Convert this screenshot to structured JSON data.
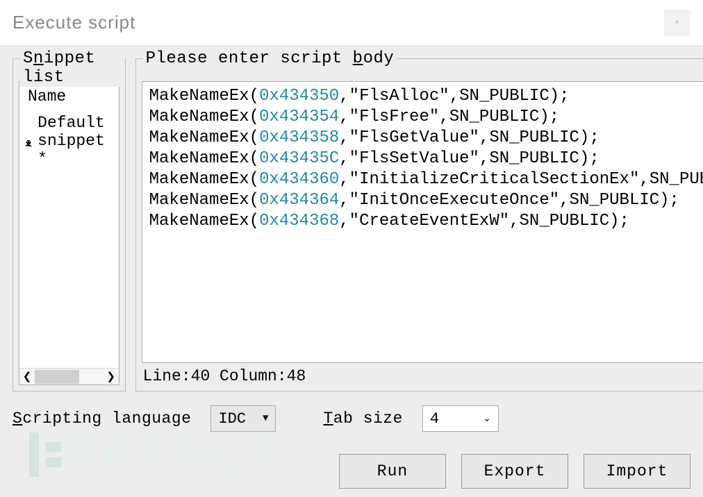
{
  "window": {
    "title": "Execute script"
  },
  "snippet_panel": {
    "legend_pre": "S",
    "legend_underlined": "n",
    "legend_post": "ippet list",
    "header": "Name",
    "items": [
      {
        "label": "Default snippet *"
      }
    ]
  },
  "script_panel": {
    "legend_pre": "Please enter script ",
    "legend_underlined": "b",
    "legend_post": "ody",
    "lines": [
      {
        "pre": "MakeNameEx(",
        "num": "0x434350",
        "post": ",\"FlsAlloc\",SN_PUBLIC);"
      },
      {
        "pre": "MakeNameEx(",
        "num": "0x434354",
        "post": ",\"FlsFree\",SN_PUBLIC);"
      },
      {
        "pre": "MakeNameEx(",
        "num": "0x434358",
        "post": ",\"FlsGetValue\",SN_PUBLIC);"
      },
      {
        "pre": "MakeNameEx(",
        "num": "0x43435C",
        "post": ",\"FlsSetValue\",SN_PUBLIC);"
      },
      {
        "pre": "MakeNameEx(",
        "num": "0x434360",
        "post": ",\"InitializeCriticalSectionEx\",SN_PUBLIC);"
      },
      {
        "pre": "MakeNameEx(",
        "num": "0x434364",
        "post": ",\"InitOnceExecuteOnce\",SN_PUBLIC);"
      },
      {
        "pre": "MakeNameEx(",
        "num": "0x434368",
        "post": ",\"CreateEventExW\",SN_PUBLIC);"
      }
    ],
    "status": "Line:40 Column:48"
  },
  "options": {
    "lang_label_underlined": "S",
    "lang_label_post": "cripting language",
    "lang_value": "IDC",
    "tab_label_underlined": "T",
    "tab_label_post": "ab size",
    "tab_value": "4"
  },
  "buttons": {
    "run": "Run",
    "export": "Export",
    "import": "Import"
  },
  "watermark": "REEBUF"
}
